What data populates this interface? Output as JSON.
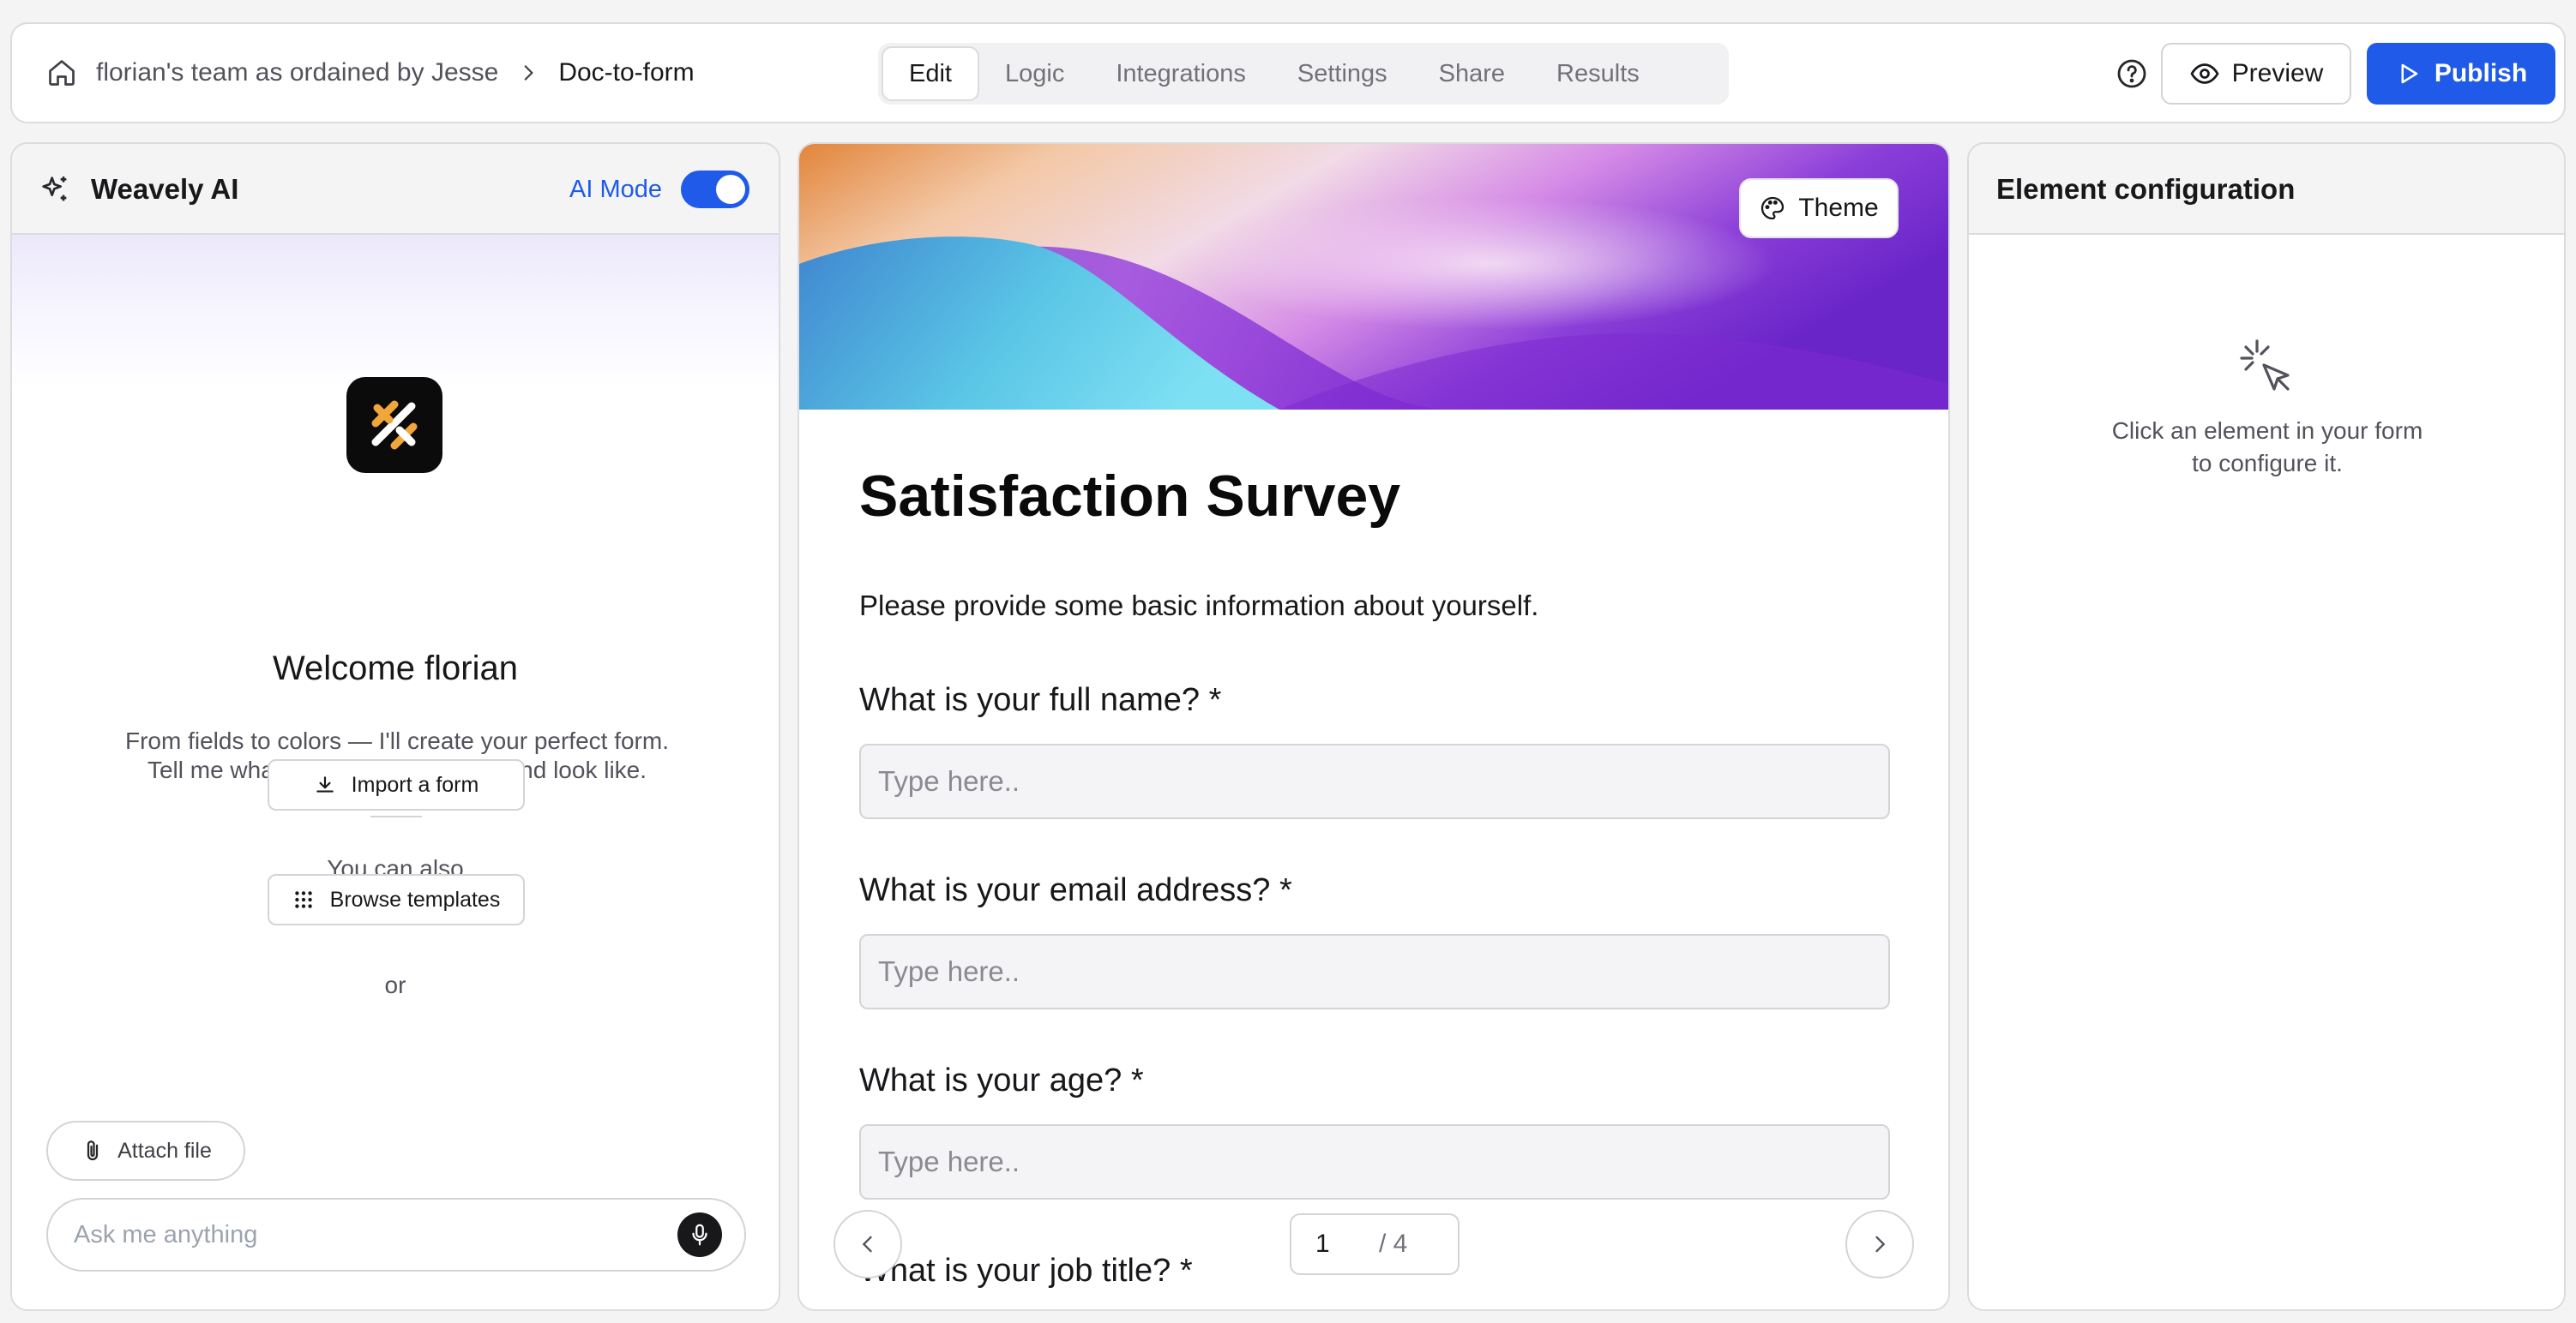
{
  "header": {
    "breadcrumb": {
      "team": "florian's team as ordained by Jesse",
      "current": "Doc-to-form"
    },
    "tabs": [
      {
        "label": "Edit",
        "active": true
      },
      {
        "label": "Logic",
        "active": false
      },
      {
        "label": "Integrations",
        "active": false
      },
      {
        "label": "Settings",
        "active": false
      },
      {
        "label": "Share",
        "active": false
      },
      {
        "label": "Results",
        "active": false
      }
    ],
    "preview_label": "Preview",
    "publish_label": "Publish"
  },
  "ai_panel": {
    "title": "Weavely AI",
    "mode_label": "AI Mode",
    "mode_enabled": true,
    "welcome": "Welcome florian",
    "intro_line1": "From fields to colors — I'll create your perfect form.",
    "intro_line2": "Tell me what your form should do and look like.",
    "you_can_also": "You can also",
    "import_label": "Import a form",
    "or_label": "or",
    "templates_label": "Browse templates",
    "attach_label": "Attach file",
    "ask_placeholder": "Ask me anything"
  },
  "form": {
    "theme_label": "Theme",
    "title": "Satisfaction Survey",
    "description": "Please provide some basic information about yourself.",
    "questions": [
      {
        "label": "What is your full name? *",
        "placeholder": "Type here.."
      },
      {
        "label": "What is your email address? *",
        "placeholder": "Type here.."
      },
      {
        "label": "What is your age? *",
        "placeholder": "Type here.."
      },
      {
        "label": "What is your job title? *"
      }
    ],
    "pager": {
      "current": "1",
      "total": "/ 4"
    }
  },
  "config_panel": {
    "title": "Element configuration",
    "hint_line1": "Click an element in your form",
    "hint_line2": "to configure it."
  },
  "colors": {
    "accent": "#1f5be8",
    "panel_border": "#dcdce0",
    "background": "#f4f4f5"
  },
  "icons": [
    "home-icon",
    "chevron-right-icon",
    "help-icon",
    "eye-icon",
    "play-icon",
    "sparkles-icon",
    "download-icon",
    "grid-icon",
    "paperclip-icon",
    "microphone-icon",
    "palette-icon",
    "chevron-left-icon",
    "cursor-click-icon"
  ]
}
